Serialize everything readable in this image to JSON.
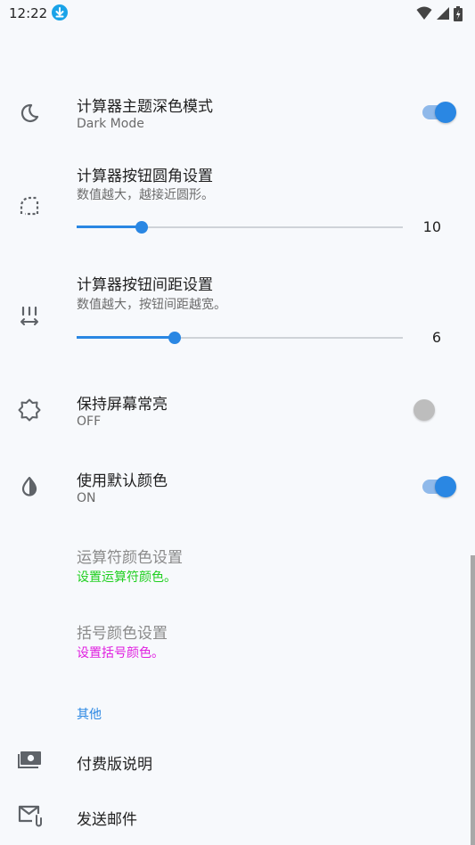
{
  "status_bar": {
    "time": "12:22"
  },
  "settings": {
    "dark_mode": {
      "title": "计算器主题深色模式",
      "subtitle": "Dark Mode",
      "enabled": true
    },
    "corner_radius": {
      "title": "计算器按钮圆角设置",
      "subtitle": "数值越大，越接近圆形。",
      "value": "10",
      "fraction": 0.2
    },
    "spacing": {
      "title": "计算器按钮间距设置",
      "subtitle": "数值越大，按钮间距越宽。",
      "value": "6",
      "fraction": 0.3
    },
    "keep_screen_on": {
      "title": "保持屏幕常亮",
      "subtitle": "OFF",
      "enabled": false
    },
    "default_colors": {
      "title": "使用默认颜色",
      "subtitle": "ON",
      "enabled": true
    },
    "operator_color": {
      "title": "运算符颜色设置",
      "subtitle": "设置运算符颜色。",
      "subtitle_color": "#20d020"
    },
    "bracket_color": {
      "title": "括号颜色设置",
      "subtitle": "设置括号颜色。",
      "subtitle_color": "#e020e0"
    }
  },
  "other": {
    "header": "其他",
    "pro_info": {
      "title": "付费版说明"
    },
    "send_email": {
      "title": "发送邮件"
    }
  },
  "colors": {
    "accent": "#2a87e3"
  },
  "icons": [
    "download-badge-icon",
    "wifi-icon",
    "signal-icon",
    "battery-icon",
    "moon-icon",
    "rounded-corner-icon",
    "spacing-icon",
    "brightness-icon",
    "contrast-drop-icon",
    "money-icon",
    "mail-icon"
  ]
}
